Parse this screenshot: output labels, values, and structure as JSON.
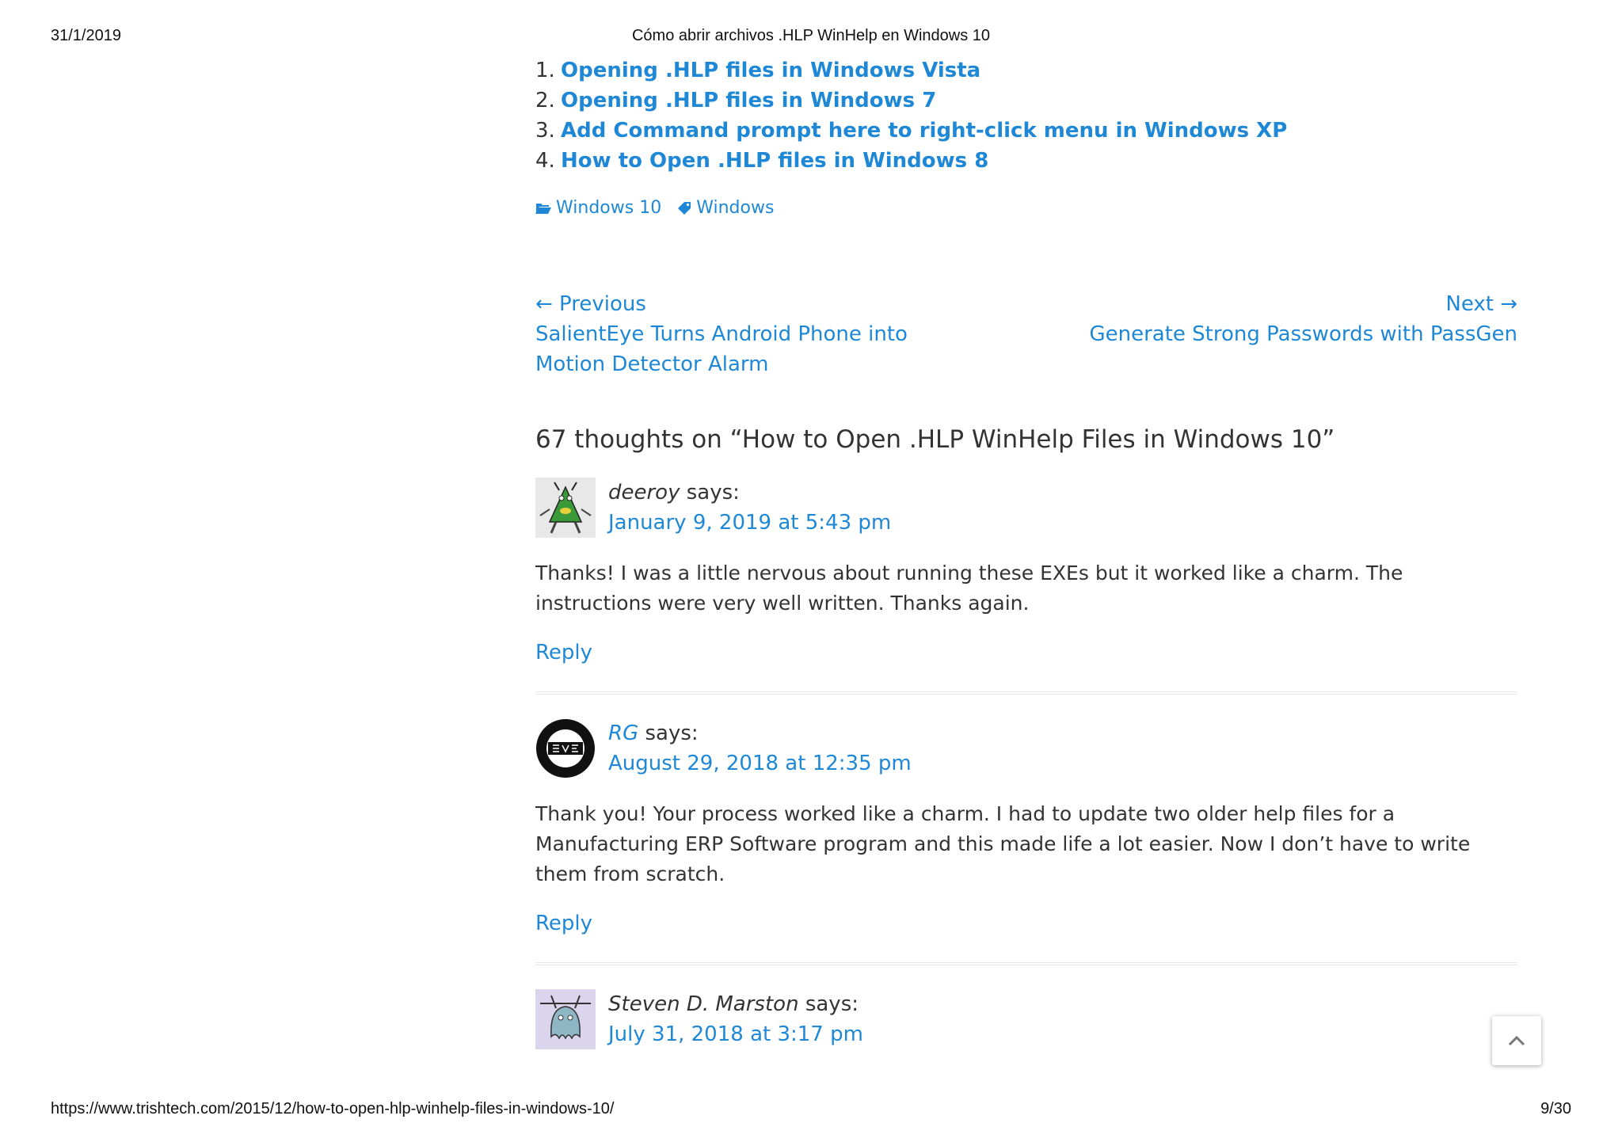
{
  "print": {
    "date": "31/1/2019",
    "title": "Cómo abrir archivos .HLP WinHelp en Windows 10",
    "url": "https://www.trishtech.com/2015/12/how-to-open-hlp-winhelp-files-in-windows-10/",
    "page": "9/30"
  },
  "related": [
    {
      "num": "1.",
      "label": "Opening .HLP files in Windows Vista"
    },
    {
      "num": "2.",
      "label": "Opening .HLP files in Windows 7"
    },
    {
      "num": "3.",
      "label": "Add Command prompt here to right-click menu in Windows XP"
    },
    {
      "num": "4.",
      "label": "How to Open .HLP files in Windows 8"
    }
  ],
  "meta": {
    "category": "Windows 10",
    "tag": "Windows",
    "category_icon": "folder-open-icon",
    "tag_icon": "tag-icon"
  },
  "postnav": {
    "prev_label": "← Previous",
    "prev_title": "SalientEye Turns Android Phone into Motion Detector Alarm",
    "next_label": "Next →",
    "next_title": "Generate Strong Passwords with PassGen"
  },
  "comments_title": "67 thoughts on “How to Open .HLP WinHelp Files in Windows 10”",
  "comments": [
    {
      "author": "deeroy",
      "says": " says:",
      "date": "January 9, 2019 at 5:43 pm",
      "body": "Thanks! I was a little nervous about running these EXEs but it worked like a charm. The instructions were very well written. Thanks again.",
      "reply": "Reply"
    },
    {
      "author": "RG",
      "says": " says:",
      "date": "August 29, 2018 at 12:35 pm",
      "body": "Thank you! Your process worked like a charm. I had to update two older help files for a Manufacturing ERP Software program and this made life a lot easier. Now I don’t have to write them from scratch.",
      "reply": "Reply"
    },
    {
      "author": "Steven D. Marston",
      "says": " says:",
      "date": "July 31, 2018 at 3:17 pm"
    }
  ],
  "colors": {
    "link": "#1e88d6",
    "text": "#333333"
  }
}
